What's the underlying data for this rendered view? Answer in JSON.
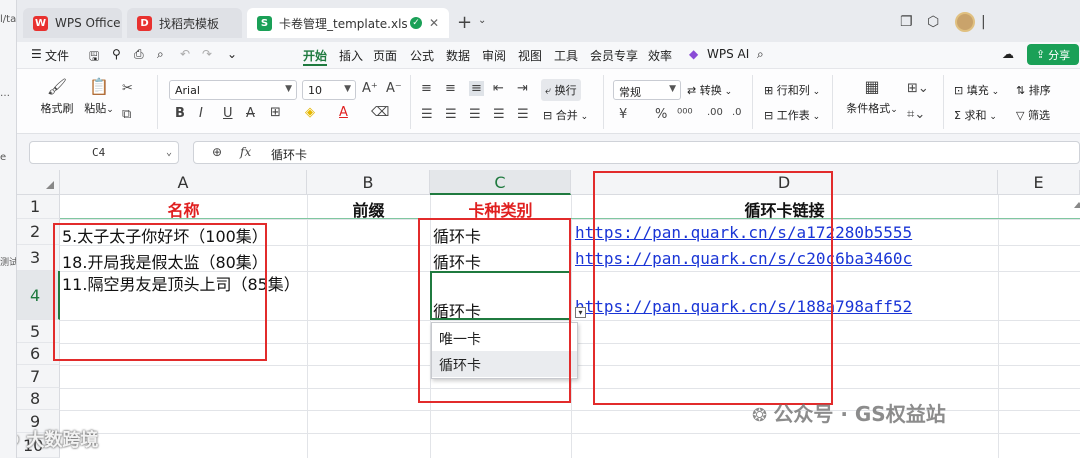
{
  "sliver": {
    "path_text": "l/ta",
    "side_text_1": "…",
    "side_text_2": "e",
    "side_text_3": "测试"
  },
  "tabs": [
    {
      "label": "WPS Office",
      "icon": "wps-logo-icon",
      "color": "#e8312f"
    },
    {
      "label": "找稻壳模板",
      "icon": "docer-icon",
      "color": "#e8312f"
    },
    {
      "label": "卡卷管理_template.xls",
      "icon": "spreadsheet-icon",
      "color": "#1aa057",
      "active": true
    }
  ],
  "window_icons": [
    "restore-icon",
    "cube-icon",
    "avatar"
  ],
  "menu": {
    "file_label": "文件",
    "items": [
      "开始",
      "插入",
      "页面",
      "公式",
      "数据",
      "审阅",
      "视图",
      "工具",
      "会员专享",
      "效率"
    ],
    "active_index": 0,
    "wps_ai_label": "WPS AI",
    "share_label": "分享"
  },
  "ribbon": {
    "format_painter": "格式刷",
    "paste": "粘贴",
    "font_name": "Arial",
    "font_size": "10",
    "wrap_label": "换行",
    "merge_label": "合并",
    "number_format": "常规",
    "convert_label": "转换",
    "rows_cols_label": "行和列",
    "worksheet_label": "工作表",
    "cond_format_label": "条件格式",
    "fill_label": "填充",
    "sort_label": "排序",
    "sum_label": "求和",
    "filter_label": "筛选",
    "currency_symbol": "¥",
    "percent_symbol": "%"
  },
  "formula_bar": {
    "cell_ref": "C4",
    "fx_label": "fx",
    "value": "循环卡"
  },
  "columns": [
    {
      "label": "A",
      "w": 247
    },
    {
      "label": "B",
      "w": 123
    },
    {
      "label": "C",
      "w": 141
    },
    {
      "label": "D",
      "w": 427
    },
    {
      "label": "E",
      "w": 125
    }
  ],
  "rows": [
    "1",
    "2",
    "3",
    "4",
    "5",
    "6",
    "7",
    "8",
    "9",
    "10"
  ],
  "header_row": {
    "a": "名称",
    "b": "前缀",
    "c": "卡种类别",
    "d": "循环卡链接"
  },
  "data_rows": [
    {
      "a": "5.太子太子你好坏（100集）",
      "c": "循环卡",
      "d": "https://pan.quark.cn/s/a172280b5555"
    },
    {
      "a": "18.开局我是假太监（80集）",
      "c": "循环卡",
      "d": "https://pan.quark.cn/s/c20c6ba3460c"
    },
    {
      "a": "11.隔空男友是顶头上司（85集）",
      "c": "循环卡",
      "d": "https://pan.quark.cn/s/188a798aff52"
    }
  ],
  "dropdown": {
    "options": [
      "唯一卡",
      "循环卡"
    ],
    "highlighted_index": 1
  },
  "annotation_color": "#e22b2b",
  "watermark_right": "公众号 · GS权益站",
  "watermark_left": "大数跨境"
}
